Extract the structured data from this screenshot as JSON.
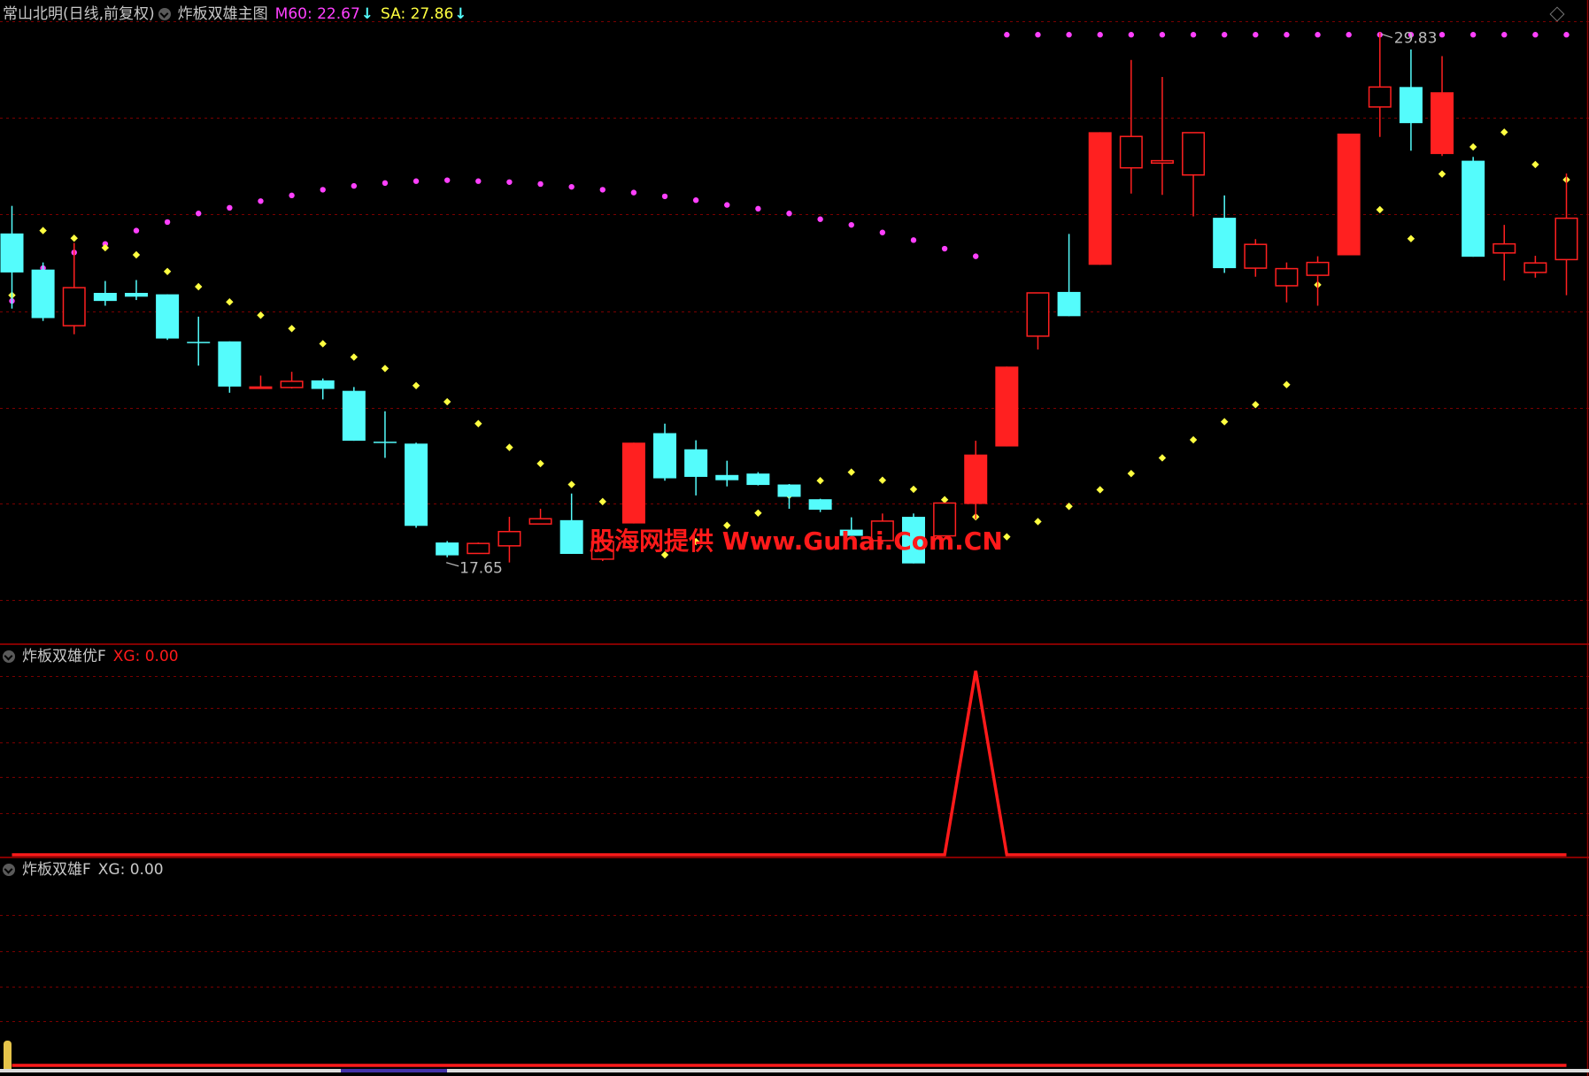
{
  "panel_main": {
    "stock_title": "常山北明(日线,前复权)",
    "indicator_name": "炸板双雄主图",
    "m60_label": "M60: 22.67",
    "sa_label": "SA: 27.86",
    "high_label": "29.83",
    "low_label": "17.65"
  },
  "panel_sub1": {
    "indicator_name": "炸板双雄优F",
    "xg_label": "XG: 0.00"
  },
  "panel_sub2": {
    "indicator_name": "炸板双雄F",
    "xg_label": "XG: 0.00"
  },
  "watermark": "股海网提供 Www.Guhai.Com.CN",
  "colors": {
    "background": "#000000",
    "up_candle": "#ff2020",
    "down_candle": "#54fcfc",
    "m60": "#ff40ff",
    "sa": "#ffff40",
    "xg_line": "#ff1a1a",
    "grid": "#7a0000",
    "title_text": "#c8c8c8"
  },
  "chart_data": [
    {
      "type": "candlestick",
      "title": "常山北明(日线,前复权)",
      "ylim": [
        16.98,
        30.51
      ],
      "grid": true,
      "series": [
        {
          "name": "M60",
          "type": "scatter"
        },
        {
          "name": "SA",
          "type": "scatter"
        }
      ],
      "candles": [
        [
          25.6,
          24.78,
          26.18,
          24.02
        ],
        [
          24.84,
          23.82,
          24.99,
          23.76
        ],
        [
          23.66,
          24.46,
          25.4,
          23.48
        ],
        [
          24.35,
          24.18,
          24.6,
          24.08
        ],
        [
          24.35,
          24.27,
          24.62,
          24.2
        ],
        [
          24.32,
          23.39,
          24.3,
          23.36
        ],
        [
          23.32,
          23.3,
          23.85,
          22.82
        ],
        [
          23.33,
          22.38,
          23.33,
          22.25
        ],
        [
          22.37,
          22.37,
          22.61,
          22.33
        ],
        [
          22.36,
          22.49,
          22.69,
          22.34
        ],
        [
          22.51,
          22.33,
          22.55,
          22.11
        ],
        [
          22.29,
          21.24,
          22.37,
          21.25
        ],
        [
          21.22,
          21.21,
          21.86,
          20.88
        ],
        [
          21.18,
          19.45,
          21.2,
          19.41
        ],
        [
          19.1,
          18.83,
          19.13,
          18.79
        ],
        [
          18.87,
          19.08,
          19.1,
          18.94
        ],
        [
          19.03,
          19.33,
          19.64,
          18.68
        ],
        [
          19.49,
          19.6,
          19.81,
          19.61
        ],
        [
          19.57,
          18.86,
          20.13,
          18.87
        ],
        [
          18.75,
          19.12,
          19.23,
          18.71
        ],
        [
          19.5,
          21.2,
          21.2,
          19.5
        ],
        [
          21.4,
          20.45,
          21.6,
          20.4
        ],
        [
          21.06,
          20.48,
          21.25,
          20.09
        ],
        [
          20.52,
          20.41,
          20.82,
          20.28
        ],
        [
          20.55,
          20.31,
          20.58,
          20.3
        ],
        [
          20.32,
          20.06,
          20.33,
          19.81
        ],
        [
          20.01,
          19.79,
          20.02,
          19.74
        ],
        [
          19.37,
          19.24,
          19.63,
          19.24
        ],
        [
          19.14,
          19.55,
          19.71,
          19.06
        ],
        [
          19.64,
          18.66,
          19.71,
          18.71
        ],
        [
          19.24,
          19.93,
          19.93,
          19.24
        ],
        [
          19.91,
          20.95,
          21.24,
          19.59
        ],
        [
          21.12,
          22.8,
          22.8,
          21.12
        ],
        [
          23.44,
          24.35,
          24.35,
          23.16
        ],
        [
          24.37,
          23.86,
          25.59,
          23.88
        ],
        [
          24.94,
          27.73,
          27.73,
          24.94
        ],
        [
          26.98,
          27.64,
          29.25,
          26.44
        ],
        [
          27.08,
          27.13,
          28.89,
          26.41
        ],
        [
          26.83,
          27.72,
          27.05,
          25.96
        ],
        [
          25.93,
          24.87,
          26.4,
          24.77
        ],
        [
          24.87,
          25.37,
          25.48,
          24.69
        ],
        [
          24.5,
          24.86,
          24.99,
          24.15
        ],
        [
          24.72,
          24.99,
          25.12,
          24.08
        ],
        [
          25.14,
          27.7,
          27.7,
          25.15
        ],
        [
          28.26,
          28.68,
          29.83,
          27.63
        ],
        [
          28.68,
          27.92,
          29.47,
          27.34
        ],
        [
          27.27,
          28.57,
          29.33,
          27.23
        ],
        [
          27.13,
          25.11,
          27.21,
          25.11
        ],
        [
          25.19,
          25.38,
          25.78,
          24.61
        ],
        [
          24.78,
          24.98,
          25.13,
          24.67
        ],
        [
          25.05,
          25.92,
          26.86,
          24.3
        ]
      ],
      "m60": [
        24.18,
        24.87,
        25.2,
        25.38,
        25.66,
        25.84,
        26.02,
        26.14,
        26.28,
        26.4,
        26.52,
        26.6,
        26.66,
        26.7,
        26.72,
        26.7,
        26.68,
        26.64,
        26.58,
        26.52,
        26.46,
        26.38,
        26.3,
        26.2,
        26.12,
        26.02,
        25.9,
        25.78,
        25.62,
        25.46,
        25.28,
        25.12,
        29.78,
        29.78,
        29.78,
        29.78,
        29.78,
        29.78,
        29.78,
        29.78,
        29.78,
        29.78,
        29.78,
        29.78,
        29.78,
        29.78,
        29.78,
        29.78,
        29.78,
        29.78,
        29.78
      ],
      "sa": [
        24.3,
        25.66,
        25.5,
        25.3,
        25.15,
        24.8,
        24.48,
        24.16,
        23.88,
        23.6,
        23.28,
        23.0,
        22.76,
        22.4,
        22.06,
        21.6,
        21.1,
        20.76,
        20.32,
        19.96,
        19.6,
        18.84,
        19.12,
        19.46,
        19.72,
        20.09,
        20.4,
        20.58,
        20.41,
        20.22,
        20.0,
        19.64,
        19.22,
        19.54,
        19.86,
        20.21,
        20.55,
        20.88,
        21.26,
        21.64,
        22.0,
        22.42,
        24.52,
        25.65,
        26.1,
        25.49,
        26.85,
        27.42,
        27.73,
        27.05,
        26.73
      ],
      "annotations": [
        "29.83",
        "17.65"
      ]
    },
    {
      "type": "line",
      "title": "炸板双雄优F",
      "series": [
        {
          "name": "XG",
          "values": [
            0,
            0,
            0,
            0,
            0,
            0,
            0,
            0,
            0,
            0,
            0,
            0,
            0,
            0,
            0,
            0,
            0,
            0,
            0,
            0,
            0,
            0,
            0,
            0,
            0,
            0,
            0,
            0,
            0,
            0,
            0,
            1,
            0,
            0,
            0,
            0,
            0,
            0,
            0,
            0,
            0,
            0,
            0,
            0,
            0,
            0,
            0,
            0,
            0,
            0,
            0
          ]
        }
      ],
      "ylim": [
        0,
        1
      ]
    },
    {
      "type": "line",
      "title": "炸板双雄F",
      "series": [
        {
          "name": "XG",
          "values": [
            0,
            0,
            0,
            0,
            0,
            0,
            0,
            0,
            0,
            0,
            0,
            0,
            0,
            0,
            0,
            0,
            0,
            0,
            0,
            0,
            0,
            0,
            0,
            0,
            0,
            0,
            0,
            0,
            0,
            0,
            0,
            0,
            0,
            0,
            0,
            0,
            0,
            0,
            0,
            0,
            0,
            0,
            0,
            0,
            0,
            0,
            0,
            0,
            0,
            0,
            0
          ]
        }
      ],
      "ylim": [
        0,
        1
      ]
    }
  ]
}
